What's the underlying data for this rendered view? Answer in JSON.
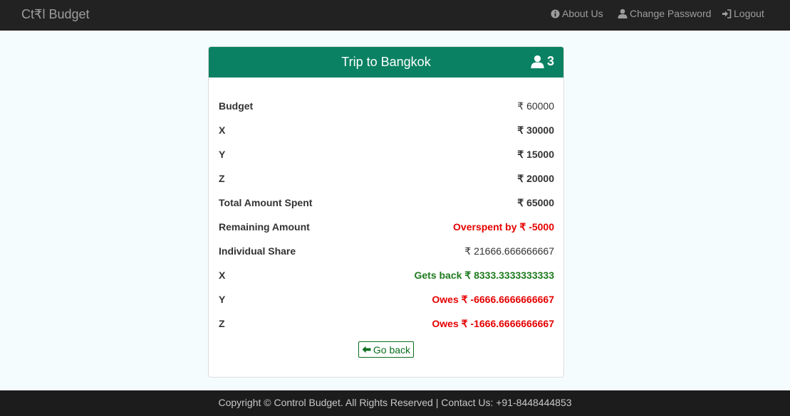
{
  "navbar": {
    "brand": "Ct₹l Budget",
    "about_label": "About Us",
    "change_password_label": "Change Password",
    "logout_label": "Logout"
  },
  "card": {
    "title": "Trip to Bangkok",
    "member_count": "3",
    "rows": [
      {
        "label": "Budget",
        "value": "₹ 60000"
      },
      {
        "label": "X",
        "value": "₹ 30000"
      },
      {
        "label": "Y",
        "value": "₹ 15000"
      },
      {
        "label": "Z",
        "value": "₹ 20000"
      },
      {
        "label": "Total Amount Spent",
        "value": "₹ 65000"
      },
      {
        "label": "Remaining Amount",
        "value": "Overspent by ₹ -5000"
      },
      {
        "label": "Individual Share",
        "value": "₹ 21666.666666667"
      },
      {
        "label": "X",
        "value": "Gets back ₹ 8333.3333333333"
      },
      {
        "label": "Y",
        "value": "Owes ₹ -6666.6666666667"
      },
      {
        "label": "Z",
        "value": "Owes ₹ -1666.6666666667"
      }
    ],
    "back_label": "Go back"
  },
  "colors": {
    "header": "#0a8163",
    "negative": "#e60000",
    "positive": "#1e7a1e",
    "navbar": "#222222"
  },
  "footer": {
    "text": "Copyright © Control Budget. All Rights Reserved | Contact Us: +91-8448444853"
  }
}
